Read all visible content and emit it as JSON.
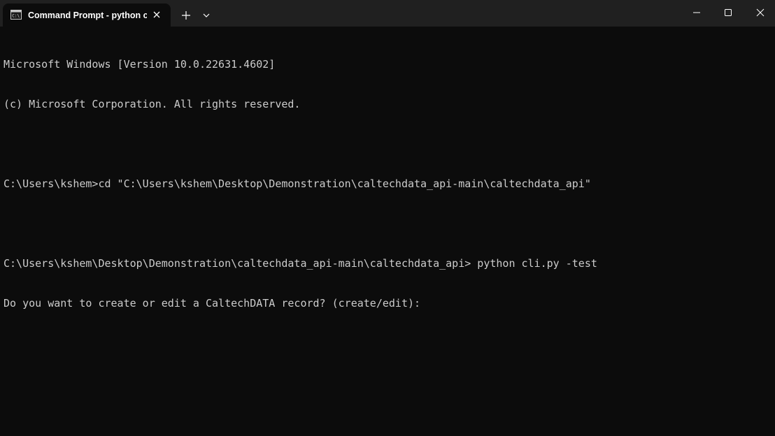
{
  "window": {
    "tab_title": "Command Prompt - python c",
    "tab_icon": "cmd-icon",
    "icons": {
      "close_tab": "close-icon",
      "new_tab": "plus-icon",
      "dropdown": "chevron-down-icon",
      "minimize": "minimize-icon",
      "maximize": "maximize-icon",
      "close_window": "close-icon"
    }
  },
  "colors": {
    "background": "#0c0c0c",
    "titlebar": "#202020",
    "text": "#cccccc"
  },
  "console": {
    "lines": [
      "Microsoft Windows [Version 10.0.22631.4602]",
      "(c) Microsoft Corporation. All rights reserved.",
      "",
      "C:\\Users\\kshem>cd \"C:\\Users\\kshem\\Desktop\\Demonstration\\caltechdata_api-main\\caltechdata_api\"",
      "",
      "C:\\Users\\kshem\\Desktop\\Demonstration\\caltechdata_api-main\\caltechdata_api> python cli.py -test",
      "Do you want to create or edit a CaltechDATA record? (create/edit):"
    ]
  }
}
